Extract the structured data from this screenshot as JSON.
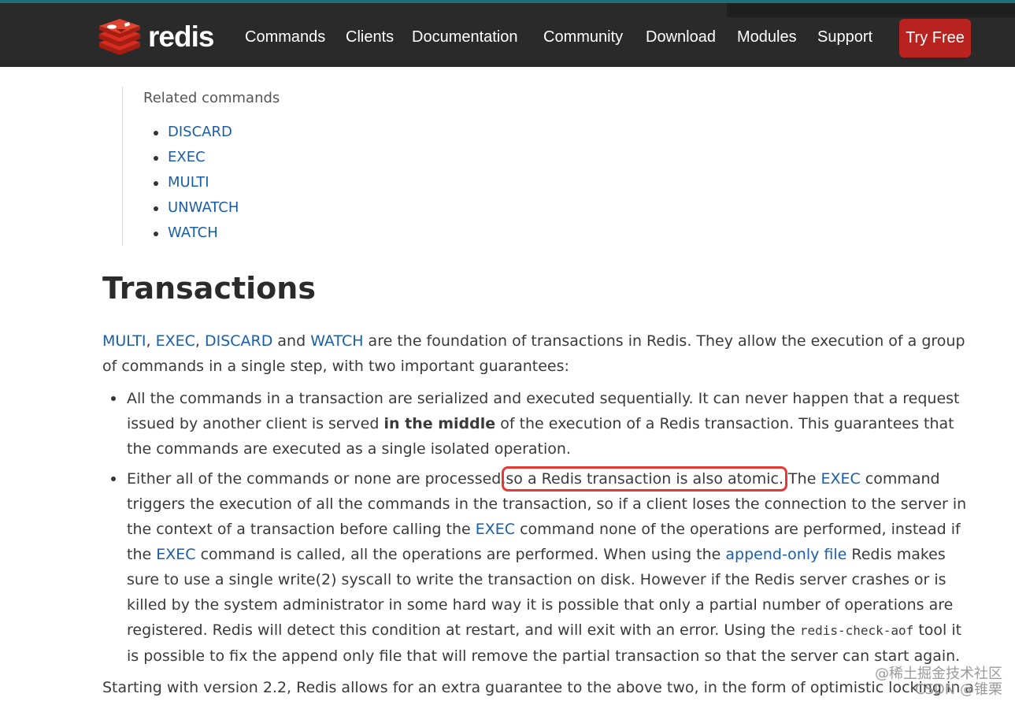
{
  "header": {
    "logo_text": "redis",
    "nav": [
      "Commands",
      "Clients",
      "Documentation",
      "Community",
      "Download",
      "Modules",
      "Support"
    ],
    "cta": "Try Free",
    "colors": {
      "bar": "#2a2a2a",
      "cta": "#b8231f",
      "logo_red": "#d82c20"
    }
  },
  "related": {
    "title": "Related commands",
    "items": [
      "DISCARD",
      "EXEC",
      "MULTI",
      "UNWATCH",
      "WATCH"
    ]
  },
  "article": {
    "title": "Transactions",
    "intro": {
      "link1": "MULTI",
      "sep1": ", ",
      "link2": "EXEC",
      "sep2": ", ",
      "link3": "DISCARD",
      "sep3": " and ",
      "link4": "WATCH",
      "text": " are the foundation of transactions in Redis. They allow the execution of a group of commands in a single step, with two important guarantees:"
    },
    "guarantee1": {
      "before": "All the commands in a transaction are serialized and executed sequentially. It can never happen that a request issued by another client is served ",
      "bold": "in the middle",
      "after": " of the execution of a Redis transaction. This guarantees that the commands are executed as a single isolated operation."
    },
    "guarantee2": {
      "p1": "Either all of the commands or none are processed,",
      "highlight": "so a Redis transaction is also atomic.",
      "p2": " The ",
      "link_exec1": "EXEC",
      "p3": " command triggers the execution of all the commands in the transaction, so if a client loses the connection to the server in the context of a transaction before calling the ",
      "link_exec2": "EXEC",
      "p4": " command none of the operations are performed, instead if the ",
      "link_exec3": "EXEC",
      "p5": " command is called, all the operations are performed. When using the ",
      "link_aof": "append-only file",
      "p6": " Redis makes sure to use a single write(2) syscall to write the transaction on disk. However if the Redis server crashes or is killed by the system administrator in some hard way it is possible that only a partial number of operations are registered. Redis will detect this condition at restart, and will exit with an error. Using the ",
      "code": "redis-check-aof",
      "p7": " tool it is possible to fix the append only file that will remove the partial transaction so that the server can start again."
    },
    "outro": "Starting with version 2.2, Redis allows for an extra guarantee to the above two, in the form of optimistic locking in a"
  },
  "watermark": {
    "line1": "@稀土掘金技术社区",
    "line2": "CSDN @锥栗"
  }
}
